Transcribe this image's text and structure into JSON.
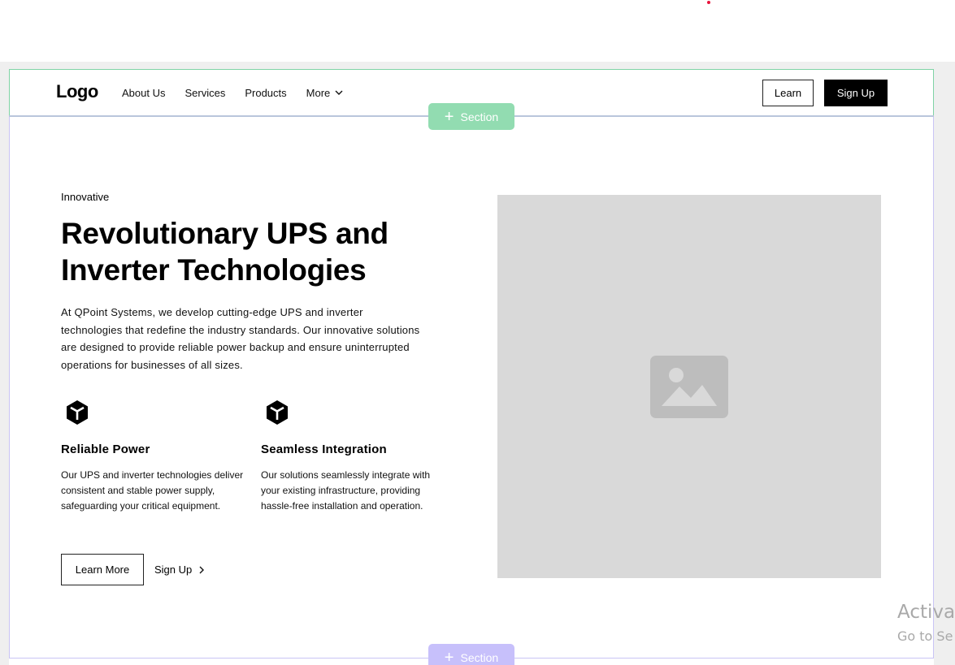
{
  "navbar": {
    "logo": "Logo",
    "links": [
      "About Us",
      "Services",
      "Products"
    ],
    "more_label": "More",
    "learn_label": "Learn",
    "signup_label": "Sign Up"
  },
  "editor": {
    "section_label": "Section",
    "section_label_bottom": "Section"
  },
  "hero": {
    "tagline": "Innovative",
    "headline": "Revolutionary UPS and Inverter Technologies",
    "description": "At QPoint Systems, we develop cutting-edge UPS and inverter technologies that redefine the industry standards. Our innovative solutions are designed to provide reliable power backup and ensure uninterrupted operations for businesses of all sizes.",
    "features": [
      {
        "icon": "cube-icon",
        "title": "Reliable Power",
        "description": "Our UPS and inverter technologies deliver consistent and stable power supply, safeguarding your critical equipment."
      },
      {
        "icon": "cube-icon",
        "title": "Seamless Integration",
        "description": "Our solutions seamlessly integrate with your existing infrastructure, providing hassle-free installation and operation."
      }
    ],
    "primary_button": "Learn More",
    "secondary_link": "Sign Up",
    "image_icon": "image-placeholder-icon"
  },
  "watermark": {
    "line1": "Activat",
    "line2": "Go to Se"
  },
  "colors": {
    "navbar_border": "#7fd3a5",
    "section_pill_green": "#92dcb1",
    "section_pill_purple": "#c7c0fb",
    "image_placeholder": "#d9d9d9",
    "accent_black": "#000000"
  }
}
